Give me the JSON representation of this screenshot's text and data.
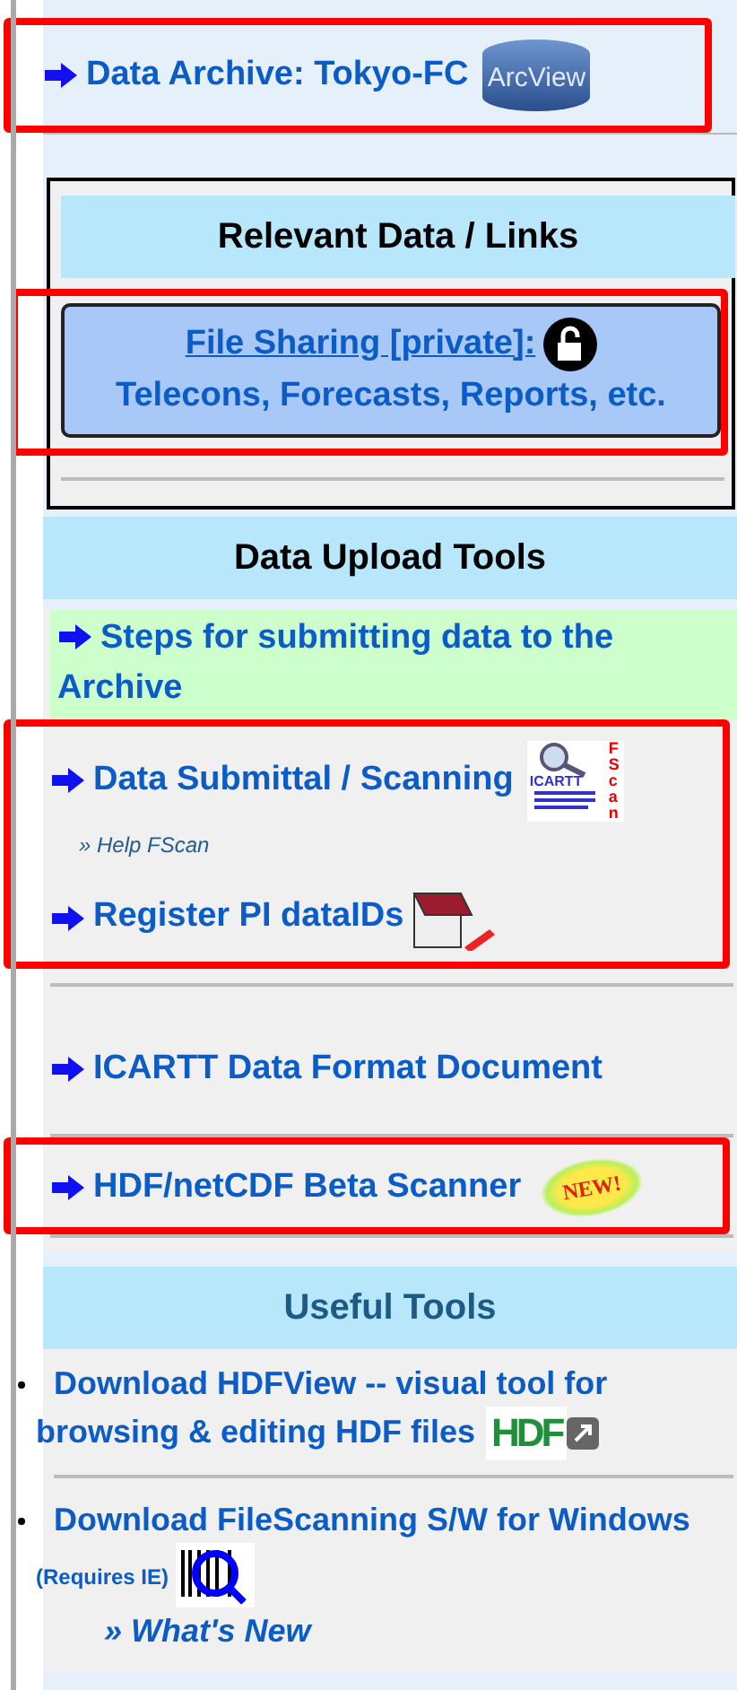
{
  "archive_link": {
    "text": "Data Archive: Tokyo-FC",
    "logo": "ArcView",
    "highlighted": true
  },
  "relevant": {
    "heading": "Relevant Data / Links",
    "file_sharing": {
      "link": "File Sharing [private]:",
      "subtitle": "Telecons, Forecasts, Reports, etc.",
      "highlighted": true
    }
  },
  "upload_tools": {
    "heading": "Data Upload Tools",
    "groups": [
      {
        "items": [
          {
            "kind": "steps",
            "text": "Steps for submitting data to the Archive"
          }
        ]
      },
      {
        "highlighted": true,
        "items": [
          {
            "kind": "fscan",
            "text": "Data Submittal / Scanning",
            "logo": "ICARTT",
            "logo_side": "FScan",
            "help": "» Help FScan"
          },
          {
            "kind": "notepad",
            "text": "Register PI dataIDs"
          }
        ]
      },
      {
        "highlighted": false,
        "items": [
          {
            "kind": "link",
            "text": "ICARTT Data Format Document"
          }
        ]
      },
      {
        "highlighted": true,
        "items": [
          {
            "kind": "new",
            "text": "HDF/netCDF Beta Scanner",
            "logo": "NEW!"
          }
        ]
      }
    ]
  },
  "useful_tools": {
    "heading": "Useful Tools",
    "items": [
      {
        "kind": "hdf",
        "text": "Download HDFView -- visual tool for browsing & editing HDF files",
        "logo": "HDF"
      },
      {
        "kind": "scanner",
        "text": "Download FileScanning S/W for Windows",
        "note": "(Requires IE)",
        "sub_link": "» What's New"
      }
    ]
  }
}
